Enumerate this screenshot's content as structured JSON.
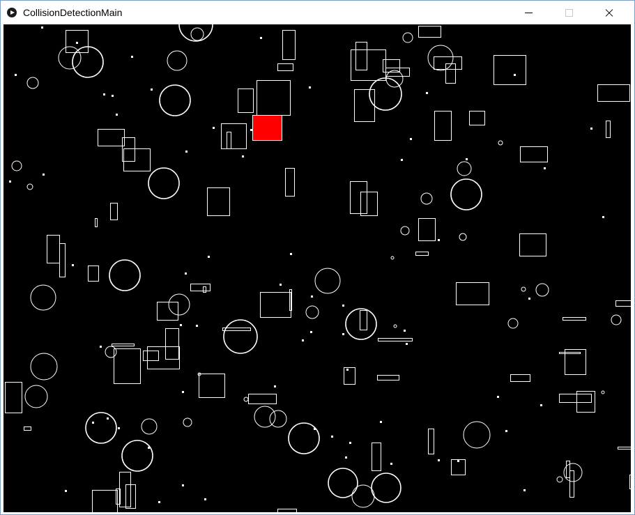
{
  "window": {
    "title": "CollisionDetectionMain",
    "app_icon": "play-circle-icon",
    "controls": {
      "minimize_icon": "minimize-icon",
      "maximize_icon": "maximize-icon",
      "close_icon": "close-icon"
    }
  },
  "colors": {
    "canvas_background": "#000000",
    "shape_stroke": "#ffffff",
    "hit_highlight": "#ff0000"
  }
}
